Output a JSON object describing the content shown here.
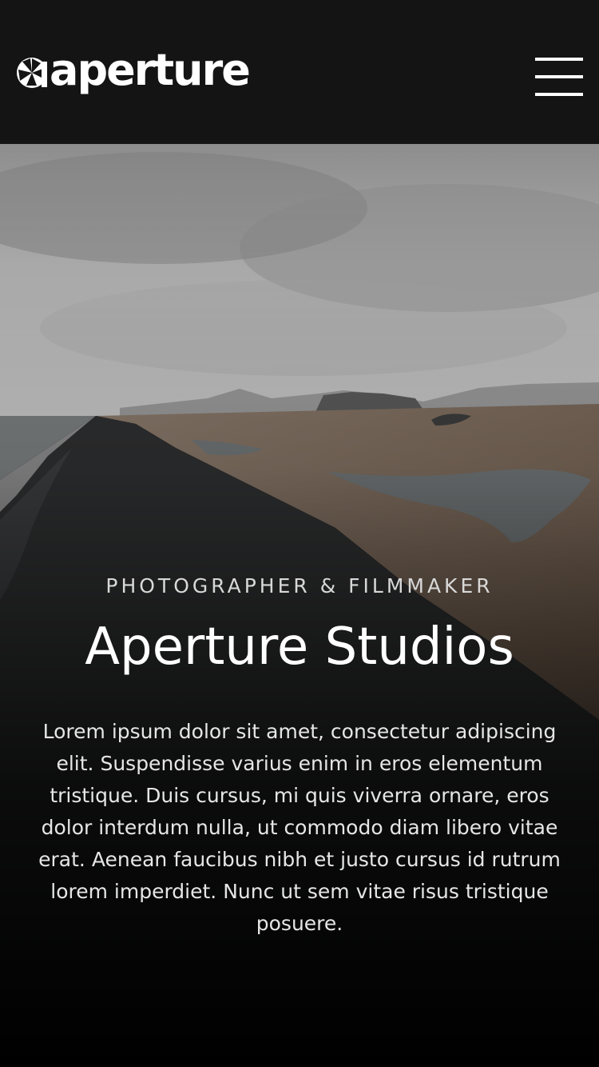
{
  "header": {
    "logo_text": "aperture",
    "logo_icon": "aperture-icon",
    "menu_icon": "hamburger-menu-icon"
  },
  "hero": {
    "eyebrow": "PHOTOGRAPHER & FILMMAKER",
    "title": "Aperture Studios",
    "description": "Lorem ipsum dolor sit amet, consectetur adipiscing elit. Suspendisse varius enim in eros elementum tristique. Duis cursus, mi quis viverra ornare, eros dolor interdum nulla, ut commodo diam libero vitae erat. Aenean faucibus nibh et justo cursus id rutrum lorem imperdiet. Nunc ut sem vitae risus tristique posuere."
  },
  "colors": {
    "header_bg": "#141414",
    "text": "#ffffff"
  }
}
